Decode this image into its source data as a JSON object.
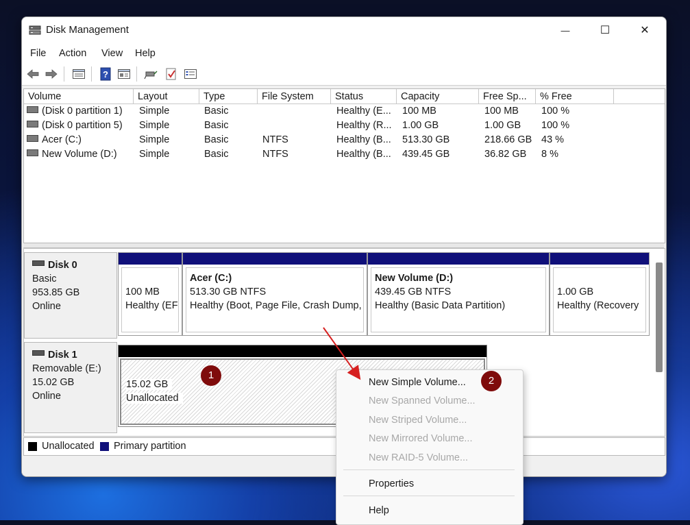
{
  "window": {
    "title": "Disk Management"
  },
  "controls": {
    "minimize": "—",
    "maximize": "☐",
    "close": "✕"
  },
  "menu": [
    "File",
    "Action",
    "View",
    "Help"
  ],
  "toolbar_icons": [
    "back-arrow-icon",
    "forward-arrow-icon",
    "list-view-icon",
    "help-icon",
    "properties-icon",
    "connect-icon",
    "check-icon",
    "details-icon"
  ],
  "volume_list": {
    "columns": [
      "Volume",
      "Layout",
      "Type",
      "File System",
      "Status",
      "Capacity",
      "Free Sp...",
      "% Free"
    ],
    "rows": [
      [
        "(Disk 0 partition 1)",
        "Simple",
        "Basic",
        "",
        "Healthy (E...",
        "100 MB",
        "100 MB",
        "100 %"
      ],
      [
        "(Disk 0 partition 5)",
        "Simple",
        "Basic",
        "",
        "Healthy (R...",
        "1.00 GB",
        "1.00 GB",
        "100 %"
      ],
      [
        "Acer (C:)",
        "Simple",
        "Basic",
        "NTFS",
        "Healthy (B...",
        "513.30 GB",
        "218.66 GB",
        "43 %"
      ],
      [
        "New Volume (D:)",
        "Simple",
        "Basic",
        "NTFS",
        "Healthy (B...",
        "439.45 GB",
        "36.82 GB",
        "8 %"
      ]
    ]
  },
  "disks": [
    {
      "name": "Disk 0",
      "type": "Basic",
      "size": "953.85 GB",
      "status": "Online",
      "partitions": [
        {
          "title": "",
          "line1": "100 MB",
          "line2": "Healthy (EF"
        },
        {
          "title": "Acer  (C:)",
          "line1": "513.30 GB NTFS",
          "line2": "Healthy (Boot, Page File, Crash Dump,"
        },
        {
          "title": "New Volume  (D:)",
          "line1": "439.45 GB NTFS",
          "line2": "Healthy (Basic Data Partition)"
        },
        {
          "title": "",
          "line1": "1.00 GB",
          "line2": "Healthy (Recovery"
        }
      ]
    },
    {
      "name": "Disk 1",
      "type": "Removable (E:)",
      "size": "15.02 GB",
      "status": "Online",
      "partitions": [
        {
          "title": "",
          "line1": "15.02 GB",
          "line2": "Unallocated"
        }
      ]
    }
  ],
  "legend": [
    {
      "label": "Unallocated",
      "color": "#000000"
    },
    {
      "label": "Primary partition",
      "color": "#10107a"
    }
  ],
  "context_menu": {
    "items": [
      {
        "label": "New Simple Volume...",
        "enabled": true
      },
      {
        "label": "New Spanned Volume...",
        "enabled": false
      },
      {
        "label": "New Striped Volume...",
        "enabled": false
      },
      {
        "label": "New Mirrored Volume...",
        "enabled": false
      },
      {
        "label": "New RAID-5 Volume...",
        "enabled": false
      },
      {
        "label": "Properties",
        "enabled": true
      },
      {
        "label": "Help",
        "enabled": true
      }
    ]
  },
  "annotations": {
    "step1": "1",
    "step2": "2",
    "color": "#7f0b0b",
    "arrow_color": "#d62020"
  }
}
